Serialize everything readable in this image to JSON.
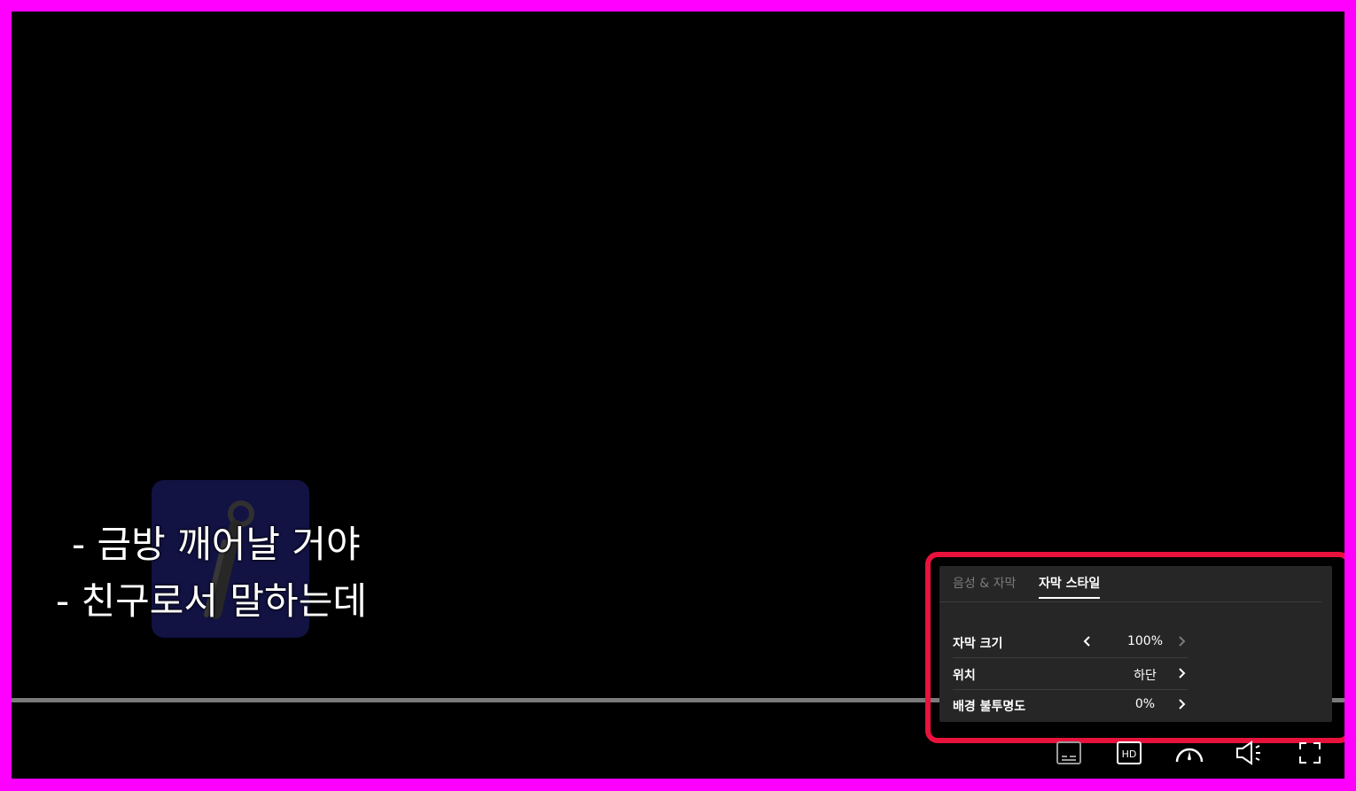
{
  "subtitles": {
    "line1": "- 금방 깨어날 거야",
    "line2": "- 친구로서 말하는데"
  },
  "settings_panel": {
    "tabs": [
      {
        "label": "음성 & 자막",
        "active": false
      },
      {
        "label": "자막 스타일",
        "active": true
      }
    ],
    "rows": [
      {
        "label": "자막 크기",
        "value": "100%"
      },
      {
        "label": "위치",
        "value": "하단"
      },
      {
        "label": "배경 불투명도",
        "value": "0%"
      }
    ]
  },
  "controls": {
    "hd_label": "HD"
  },
  "colors": {
    "highlight_border": "#e8123c",
    "frame": "#ff00ff",
    "panel_bg": "#262626"
  }
}
